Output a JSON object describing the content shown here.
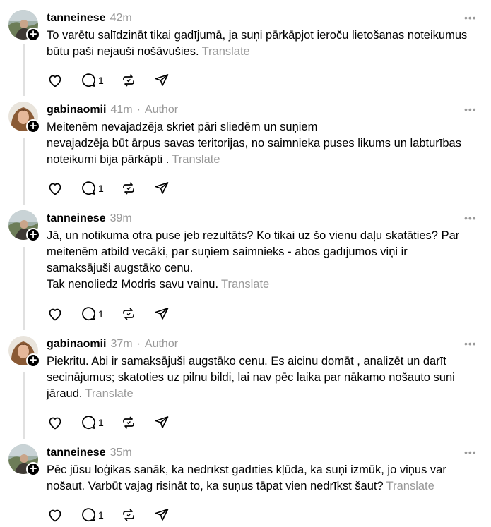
{
  "posts": [
    {
      "username": "tanneinese",
      "time": "42m",
      "author_label": "",
      "lines": [
        "To varētu salīdzināt tikai gadījumā, ja suņi pārkāpjot ieroču lietošanas noteikumus",
        "būtu paši nejauši nošāvušies."
      ],
      "translate": "Translate",
      "reply_count": "1"
    },
    {
      "username": "gabinaomii",
      "time": "41m",
      "author_label": "Author",
      "lines": [
        "Meitenēm nevajadzēja skriet pāri sliedēm un suņiem",
        "nevajadzēja būt ārpus savas teritorijas, no saimnieka puses likums un labturības",
        "noteikumi bija pārkāpti ."
      ],
      "translate": "Translate",
      "reply_count": "1"
    },
    {
      "username": "tanneinese",
      "time": "39m",
      "author_label": "",
      "lines": [
        "Jā, un notikuma otra puse jeb rezultāts? Ko tikai uz šo vienu daļu skatāties? Par",
        "meitenēm atbild vecāki, par suņiem saimnieks - abos gadījumos viņi ir",
        "samaksājuši augstāko cenu.",
        "Tak nenoliedz Modris savu vainu."
      ],
      "translate": "Translate",
      "reply_count": "1"
    },
    {
      "username": "gabinaomii",
      "time": "37m",
      "author_label": "Author",
      "lines": [
        "Piekritu. Abi ir samaksājuši augstāko cenu. Es aicinu domāt , analizēt un darīt",
        "secinājumus; skatoties uz pilnu bildi, lai nav pēc laika par nākamo nošauto suni",
        "jāraud."
      ],
      "translate": "Translate",
      "reply_count": "1"
    },
    {
      "username": "tanneinese",
      "time": "35m",
      "author_label": "",
      "lines": [
        "Pēc jūsu loģikas sanāk, ka nedrīkst gadīties kļūda, ka suņi izmūk, jo viņus var",
        "nošaut. Varbūt vajag risināt to, ka suņus tāpat vien nedrīkst šaut?"
      ],
      "translate": "Translate",
      "reply_count": "1"
    }
  ],
  "separator": "·",
  "follow_symbol": "+",
  "more_symbol": "•••",
  "icons": {
    "like": "heart-icon",
    "reply": "reply-bubble-icon",
    "repost": "repost-icon",
    "share": "send-icon",
    "more": "more-dots-icon",
    "follow": "plus-icon"
  }
}
